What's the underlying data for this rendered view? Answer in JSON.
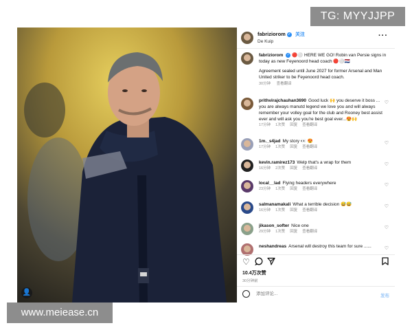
{
  "watermarks": {
    "top": "TG: MYYJJPP",
    "bottom": "www.meiease.cn"
  },
  "post": {
    "header": {
      "username": "fabriziorom",
      "follow": "关注",
      "location": "De Kuip"
    },
    "caption": {
      "username": "fabriziorom",
      "headline": "🔴⚪ HERE WE GO! Robin van Persie signs in today as new Feyenoord head coach 🔴⚪🇳🇱",
      "body": "Agreement sealed until June 2027 for former Arsenal and Man United striker to be Feyenoord head coach.",
      "time": "30分钟",
      "translate": "查看翻译"
    },
    "comments": [
      {
        "username": "prithvirajchauhan3690",
        "text": "Good luck 🙌 you deserve it boss ... you are always manutd legend we love you and will always remember your volley goal for the club and Rooney best assist ever and will ask you you're best goal ever...😍🙌",
        "time": "17分钟",
        "likes": "1次赞",
        "reply": "回复",
        "translate": "查看翻译"
      },
      {
        "username": "1m._s4jad",
        "text": "My story 👀 😍",
        "time": "17分钟",
        "likes": "1次赞",
        "reply": "回复",
        "translate": "查看翻译"
      },
      {
        "username": "kevin.ramirez173",
        "text": "Welp that's a wrap for them",
        "time": "16分钟",
        "likes": "2次赞",
        "reply": "回复",
        "translate": "查看翻译"
      },
      {
        "username": "local__lad",
        "text": "Flying headers everywhere",
        "time": "23分钟",
        "likes": "1次赞",
        "reply": "回复",
        "translate": "查看翻译"
      },
      {
        "username": "salmanamakali",
        "text": "What a terrible decision 😅😅",
        "time": "16分钟",
        "likes": "1次赞",
        "reply": "回复",
        "translate": "查看翻译"
      },
      {
        "username": "jikason_softer",
        "text": "Nice one",
        "time": "29分钟",
        "likes": "1次赞",
        "reply": "回复",
        "translate": "查看翻译"
      },
      {
        "username": "neshandreas",
        "text": "Arsenal will destroy this team for sure ......",
        "time": "",
        "likes": "",
        "reply": "",
        "translate": ""
      }
    ],
    "actions": {
      "like_icon": "heart-outline",
      "comment_icon": "speech-bubble",
      "share_icon": "paper-plane",
      "save_icon": "bookmark"
    },
    "likes": "10.4万次赞",
    "posted": "30分钟前",
    "add_comment": {
      "placeholder": "添加评论...",
      "post_label": "发布"
    }
  }
}
